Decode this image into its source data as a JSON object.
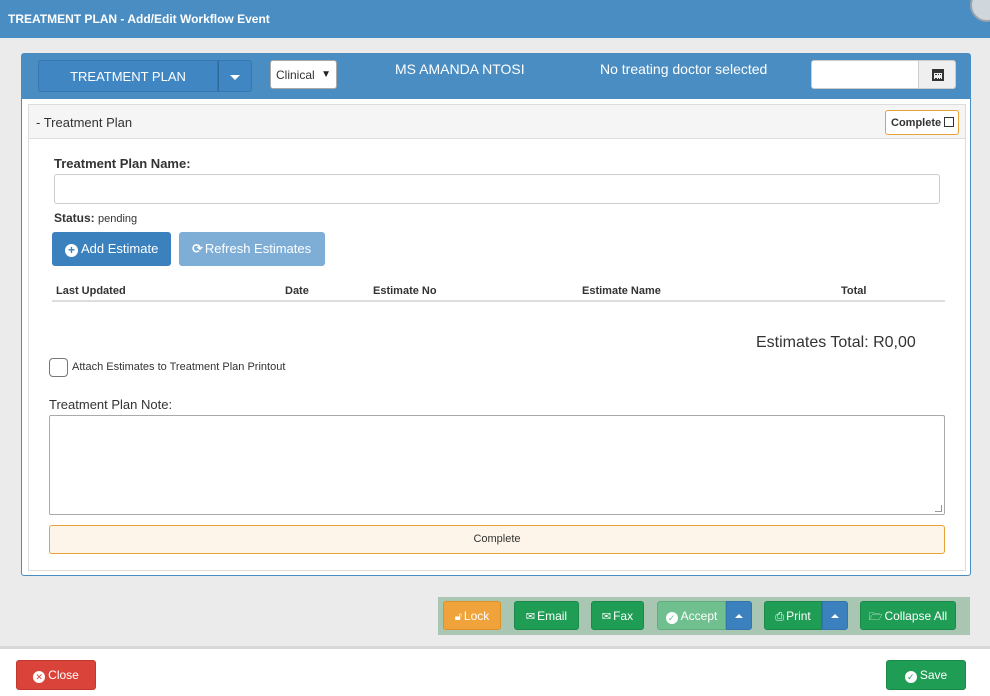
{
  "window": {
    "title": "TREATMENT PLAN - Add/Edit Workflow Event"
  },
  "header": {
    "plan_button_label": "TREATMENT PLAN",
    "category_select_value": "Clinical",
    "patient_name": "MS AMANDA NTOSI",
    "doctor_status": "No treating doctor selected",
    "date_value": ""
  },
  "section": {
    "title": "- Treatment Plan",
    "complete_checkbox_label": "Complete",
    "name_label": "Treatment Plan Name:",
    "name_value": "",
    "status_label": "Status:",
    "status_value": "pending",
    "add_estimate_label": "Add Estimate",
    "refresh_estimates_label": "Refresh Estimates",
    "table_columns": [
      "Last Updated",
      "Date",
      "Estimate No",
      "Estimate Name",
      "Total"
    ],
    "estimates_total": "Estimates Total: R0,00",
    "attach_label": "Attach Estimates to Treatment Plan Printout",
    "note_label": "Treatment Plan Note:",
    "note_value": "",
    "complete_button_label": "Complete"
  },
  "toolbar": {
    "lock": "Lock",
    "email": "Email",
    "fax": "Fax",
    "accept": "Accept",
    "print": "Print",
    "collapse_all": "Collapse All"
  },
  "footer": {
    "close": "Close",
    "save": "Save"
  },
  "colors": {
    "header_blue": "#4a8dc2",
    "lock_orange": "#f0a33a",
    "success_green": "#1f9d55",
    "danger_red": "#d9433a"
  }
}
